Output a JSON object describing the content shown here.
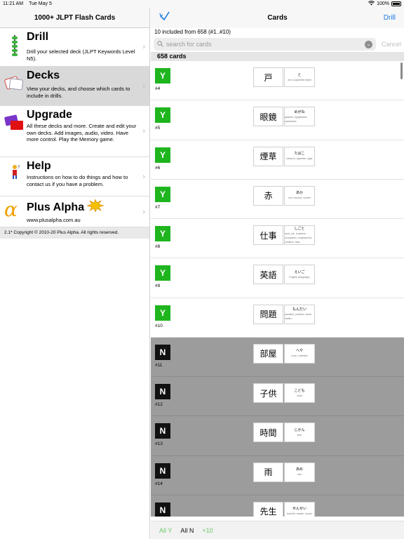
{
  "status_bar": {
    "time": "11:21 AM",
    "date": "Tue May 5",
    "battery": "100%"
  },
  "master": {
    "title": "1000+ JLPT Flash Cards",
    "items": [
      {
        "title": "Drill",
        "desc": "Drill your selected deck (JLPT Keywords Level N5).",
        "icon": "abacus-icon",
        "selected": false
      },
      {
        "title": "Decks",
        "desc": "View your decks, and choose which cards to include in drills.",
        "icon": "cards-icon",
        "selected": true
      },
      {
        "title": "Upgrade",
        "desc": "All these decks and more. Create and edit your own decks. Add images, audio, video. Have more control. Play the Memory game.",
        "icon": "upgrade-cards-icon",
        "selected": false
      },
      {
        "title": "Help",
        "desc": "Instructions on how to do things and how to contact us if you have a problem.",
        "icon": "help-figure-icon",
        "selected": false
      },
      {
        "title": "Plus Alpha",
        "desc": "www.plusalpha.com.au",
        "icon": "alpha-logo-icon",
        "selected": false
      }
    ],
    "copyright": "2.1* Copyright © 2010-20 Plus Alpha. All rights reserved."
  },
  "detail": {
    "nav_title": "Cards",
    "drill_label": "Drill",
    "summary": "10 included from 658 (#1..#10)",
    "search": {
      "placeholder": "search for cards",
      "cancel_label": "Cancel"
    },
    "section_header": "658 cards",
    "cards": [
      {
        "flag": "Y",
        "number": "#4",
        "kanji": "戸",
        "kana": "と",
        "meaning": "door (Japanese style)"
      },
      {
        "flag": "Y",
        "number": "#5",
        "kanji": "眼鏡",
        "kana": "めがね",
        "meaning": "glasses, eyeglasses, spectacles"
      },
      {
        "flag": "Y",
        "number": "#6",
        "kanji": "煙草",
        "kana": "たばこ",
        "meaning": "tobacco, cigarette, cigar"
      },
      {
        "flag": "Y",
        "number": "#7",
        "kanji": "赤",
        "kana": "あか",
        "meaning": "red, crimson, scarlet"
      },
      {
        "flag": "Y",
        "number": "#8",
        "kanji": "仕事",
        "kana": "しごと",
        "meaning": "work, job, business, occupation, employment, vocation, task"
      },
      {
        "flag": "Y",
        "number": "#9",
        "kanji": "英語",
        "kana": "えいご",
        "meaning": "English (language)"
      },
      {
        "flag": "Y",
        "number": "#10",
        "kanji": "問題",
        "kana": "もんだい",
        "meaning": "question, problem, issue, matter"
      },
      {
        "flag": "N",
        "number": "#11",
        "kanji": "部屋",
        "kana": "へや",
        "meaning": "room, chamber"
      },
      {
        "flag": "N",
        "number": "#12",
        "kanji": "子供",
        "kana": "こども",
        "meaning": "child"
      },
      {
        "flag": "N",
        "number": "#13",
        "kanji": "時間",
        "kana": "じかん",
        "meaning": "time"
      },
      {
        "flag": "N",
        "number": "#14",
        "kanji": "雨",
        "kana": "あめ",
        "meaning": "rain"
      },
      {
        "flag": "N",
        "number": "",
        "kanji": "先生",
        "kana": "せんせい",
        "meaning": "teacher, master, doctor"
      }
    ],
    "bottom": {
      "all_y": "All Y",
      "all_n": "All N",
      "plus_ten": "+10"
    }
  },
  "colors": {
    "accent": "#1a7ce0",
    "yes": "#1fb51f",
    "no": "#111111",
    "excluded_bg": "#9c9c9c"
  }
}
